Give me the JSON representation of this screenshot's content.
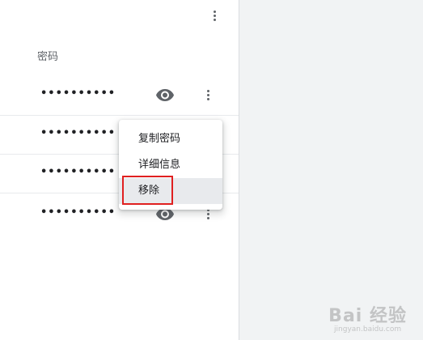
{
  "header": {
    "more_icon": "more-vert-icon"
  },
  "table": {
    "column_label": "密码",
    "rows": [
      {
        "password_mask": "••••••••••"
      },
      {
        "password_mask": "••••••••••"
      },
      {
        "password_mask": "••••••••••"
      },
      {
        "password_mask": "••••••••••"
      }
    ]
  },
  "context_menu": {
    "items": [
      {
        "label": "复制密码"
      },
      {
        "label": "详细信息"
      },
      {
        "label": "移除"
      }
    ],
    "hovered_item": "移除"
  },
  "annotation": {
    "highlight_color": "#e02020"
  },
  "watermark": {
    "main": "Bai 经验",
    "sub": "jingyan.baidu.com"
  },
  "colors": {
    "right_panel_bg": "#f1f3f4",
    "icon_gray": "#5f6368",
    "text_dark": "#202124"
  }
}
